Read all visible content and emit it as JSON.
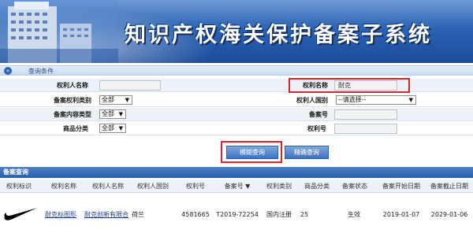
{
  "banner": {
    "title": "知识产权海关保护备案子系统"
  },
  "query": {
    "label": "查询条件",
    "arrow": "»"
  },
  "form": {
    "holder_name_label": "权利人名称",
    "holder_name_value": "",
    "right_name_label": "权利名称",
    "right_name_value": "耐克",
    "right_category_label": "备案权利类别",
    "right_category_value": "全部",
    "holder_country_label": "权利人国别",
    "holder_country_value": "--请选择--",
    "content_type_label": "备案内容类型",
    "content_type_value": "全部",
    "record_no_label": "备案号",
    "record_no_value": "",
    "goods_class_label": "商品分类",
    "goods_class_value": "全部",
    "right_no_label": "权利号",
    "right_no_value": ""
  },
  "buttons": {
    "fuzzy": "模糊查询",
    "exact": "精确查询"
  },
  "results": {
    "title": "备案查询",
    "columns": [
      "权利标识",
      "权利名称",
      "权利人名称",
      "权利人国别",
      "权利号",
      "备案号 ▼",
      "权利类别",
      "商品分类",
      "备案状态",
      "备案开始日期",
      "备案截止日期"
    ],
    "rows": [
      {
        "logo": "nike-swoosh",
        "name": "耐克标图形",
        "holder": "耐克创新有限合",
        "country": "荷兰",
        "right_no": "4581665",
        "record_no": "T2019-72254",
        "category": "国内注册",
        "goods": "25",
        "status": "生效",
        "start": "2019-01-07",
        "end": "2029-01-06"
      }
    ]
  },
  "colors": {
    "highlight": "#d9252b",
    "accent": "#2f64b8"
  }
}
